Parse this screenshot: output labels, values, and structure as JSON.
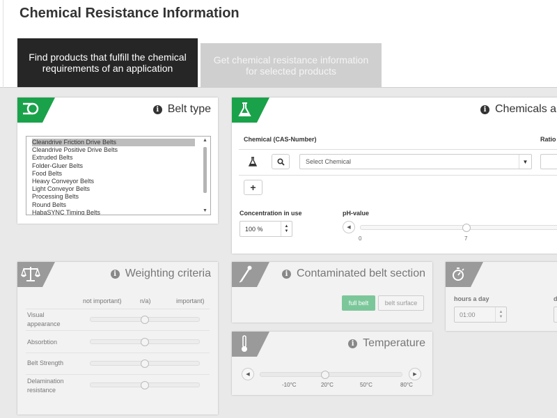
{
  "page": {
    "title": "Chemical Resistance Information"
  },
  "tabs": [
    {
      "label": "Find products that fulfill the chemical requirements of an application"
    },
    {
      "label": "Get chemical resistance information for selected products"
    }
  ],
  "belt_type": {
    "title": "Belt type",
    "icon": "belt-icon",
    "items": [
      "Cleandrive Friction Drive Belts",
      "Cleandrive Positive Drive Belts",
      "Extruded Belts",
      "Folder-Gluer Belts",
      "Food Belts",
      "Heavy Conveyor Belts",
      "Light Conveyor Belts",
      "Processing Belts",
      "Round Belts",
      "HabaSYNC Timing Belts"
    ],
    "selected": "Cleandrive Friction Drive Belts"
  },
  "chemicals": {
    "title": "Chemicals a",
    "icon": "flask-icon",
    "col_chemical": "Chemical (CAS-Number)",
    "col_ratio": "Ratio",
    "select_placeholder": "Select Chemical",
    "add_label": "+",
    "concentration_label": "Concentration in use",
    "concentration_value": "100 %",
    "ph_label": "pH-value",
    "ph_tick_0": "0",
    "ph_tick_7": "7",
    "ph_value": 7
  },
  "weighting": {
    "title": "Weighting criteria",
    "icon": "scales-icon",
    "head_left": "not important)",
    "head_mid": "n/a)",
    "head_right": "important)",
    "rows": [
      {
        "label": "Visual appearance",
        "value": 0.5
      },
      {
        "label": "Absorbtion",
        "value": 0.5
      },
      {
        "label": "Belt Strength",
        "value": 0.5
      },
      {
        "label": "Delamination resistance",
        "value": 0.5
      }
    ]
  },
  "contaminated": {
    "title": "Contaminated belt section",
    "icon": "pipette-icon",
    "full_belt": "full belt",
    "belt_surface": "belt surface",
    "active_color": "#7cc79a"
  },
  "temperature": {
    "title": "Temperature",
    "icon": "thermometer-icon",
    "ticks": [
      "-10°C",
      "20°C",
      "50°C",
      "80°C"
    ],
    "value_label": "20°C"
  },
  "duration": {
    "icon": "stopwatch-icon",
    "hours_label": "hours a day",
    "hours_value": "01:00",
    "days_label": "d"
  },
  "colors": {
    "brand_green": "#1aa24a",
    "disabled_gray": "#9a9a9a",
    "tab_dark": "#262626"
  }
}
